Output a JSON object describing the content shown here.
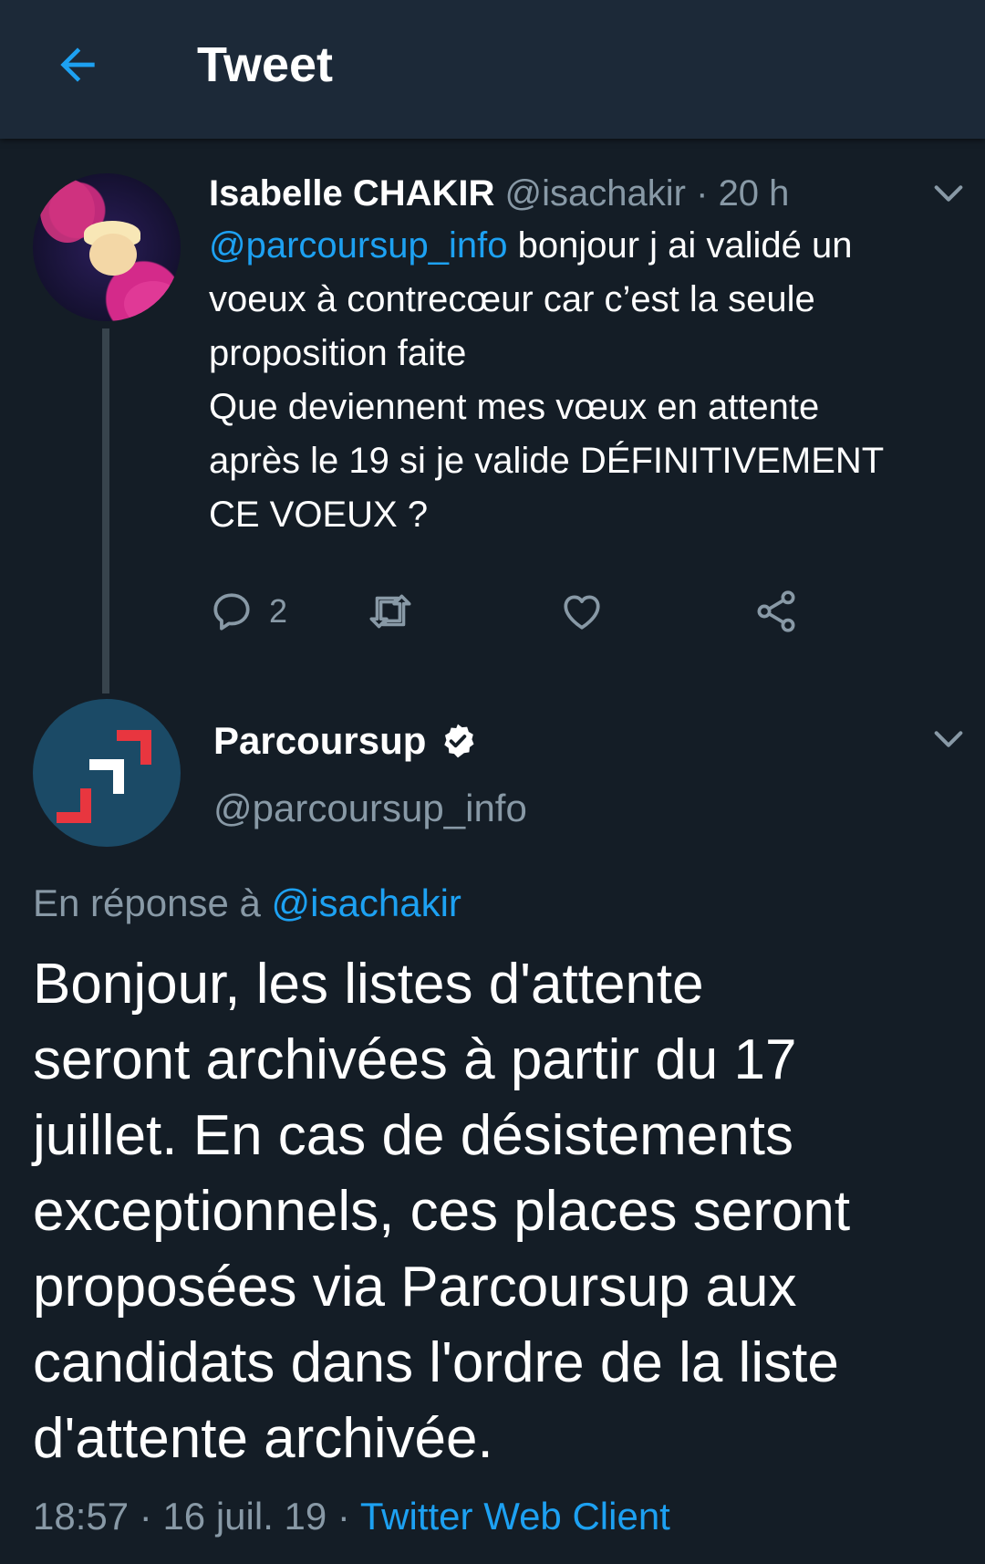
{
  "header": {
    "title": "Tweet"
  },
  "tweet1": {
    "author_name": "Isabelle CHAKIR",
    "handle": "@isachakir",
    "separator": "·",
    "time": "20 h",
    "mention": "@parcoursup_info",
    "text_lines": [
      "bonjour j ai validé un",
      "voeux à contrecœur car c’est la seule",
      "proposition faite",
      "Que deviennent mes vœux en attente",
      "après le 19 si je valide DÉFINITIVEMENT",
      "CE VOEUX ?"
    ],
    "reply_count": "2"
  },
  "tweet2": {
    "author_name": "Parcoursup",
    "handle": "@parcoursup_info",
    "reply_prefix": "En réponse à",
    "reply_handle": "@isachakir",
    "text_lines": [
      "Bonjour, les listes d'attente",
      "seront archivées à partir du 17",
      "juillet. En cas de désistements",
      "exceptionnels, ces places seront",
      "proposées via Parcoursup aux",
      "candidats dans l'ordre de la liste",
      "d'attente archivée."
    ],
    "time": "18:57",
    "date": "16 juil. 19",
    "separator": "·",
    "client": "Twitter Web Client"
  },
  "icons": {
    "back": "arrow-left-icon",
    "reply": "reply-icon",
    "retweet": "retweet-icon",
    "like": "heart-icon",
    "share": "share-icon",
    "caret": "chevron-down-icon",
    "verified": "verified-badge-icon"
  },
  "colors": {
    "background": "#141d26",
    "header_background": "#1c2938",
    "accent": "#1da1f2",
    "secondary_text": "#8899a6",
    "thread_line": "#38444d"
  }
}
